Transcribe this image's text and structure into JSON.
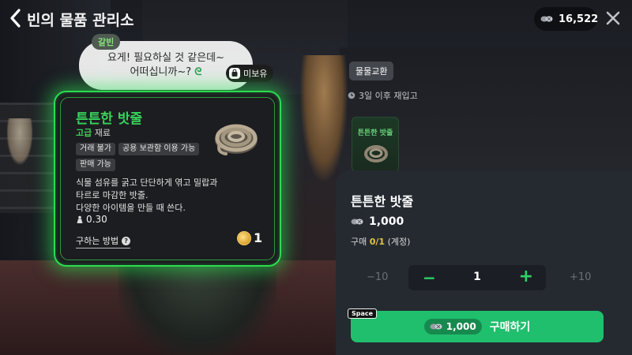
{
  "header": {
    "title": "빈의 물품 관리소",
    "currency_value": "16,522"
  },
  "dialog": {
    "speaker": "갈빈",
    "line1": "요게! 필요하실 것 같은데~",
    "line2": "어떠십니까~?",
    "swirl": "ᘓ"
  },
  "ownership_badge": "미보유",
  "item": {
    "name": "튼튼한 밧줄",
    "grade": "고급",
    "type": "재료",
    "tags": [
      "거래 불가",
      "공용 보관함 이용 가능",
      "판매 가능"
    ],
    "desc_line1": "식물 섬유를 굵고 단단하게 엮고 밀랍과",
    "desc_line2": "타르로 마감한 밧줄.",
    "desc_line3": "다양한 아이템을 만들 때 쓴다.",
    "weight": "0.30",
    "howto_label": "구하는 방법",
    "help_glyph": "?",
    "owned": "1"
  },
  "exchange": {
    "tab_label": "물물교환",
    "restock_text": "3일 이후 재입고",
    "slot_name": "튼튼한 밧줄"
  },
  "purchase": {
    "name": "튼튼한 밧줄",
    "price": "1,000",
    "limit_prefix": "구매 ",
    "limit_value": "0/1",
    "limit_suffix": " (계정)",
    "minus10": "−10",
    "dec_glyph": "−",
    "quantity": "1",
    "inc_glyph": "+",
    "plus10": "+10",
    "button_price": "1,000",
    "button_label": "구매하기",
    "hotkey": "Space"
  },
  "icons": {
    "back": "chevron-left-icon",
    "close": "close-icon",
    "currency": "coin-icon",
    "weight": "weight-icon",
    "clock": "clock-icon",
    "help": "help-icon"
  },
  "colors": {
    "accent_green": "#2bdc4e",
    "buy_button": "#1fbf6d",
    "panel_bg": "#252a31",
    "limit_value": "#e0c448"
  }
}
